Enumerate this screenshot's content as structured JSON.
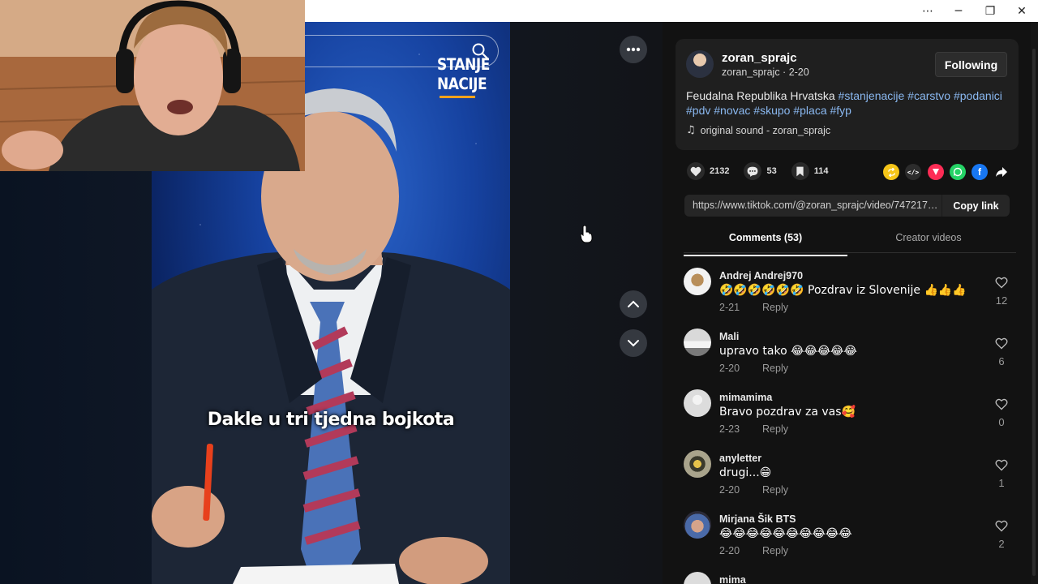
{
  "window": {
    "more_icon": "⋯",
    "minimize_icon": "─",
    "restore_icon": "❐",
    "close_icon": "✕"
  },
  "video": {
    "logo_line1": "STANJE",
    "logo_line2": "NACIJE",
    "subtitle": "Dakle u tri tjedna bojkota",
    "more_icon": "ellipsis-icon",
    "prev_icon": "chevron-up-icon",
    "next_icon": "chevron-down-icon"
  },
  "author": {
    "name": "zoran_sprajc",
    "handle": "zoran_sprajc",
    "separator": " · ",
    "date": "2-20",
    "follow_label": "Following"
  },
  "description": {
    "text": "Feudalna Republika Hrvatska ",
    "tags": [
      "#stanjenacije",
      "#carstvo",
      "#podanici",
      "#pdv",
      "#novac",
      "#skupo",
      "#placa",
      "#fyp"
    ],
    "sound": "original sound - zoran_sprajc"
  },
  "stats": {
    "likes": "2132",
    "comments": "53",
    "saves": "114"
  },
  "share_colors": {
    "repost": "#f5c518",
    "embed": "#2c2c2c",
    "send": "#fe2c55",
    "whatsapp": "#25d366",
    "facebook": "#1877f2"
  },
  "link": {
    "url": "https://www.tiktok.com/@zoran_sprajc/video/7472171...",
    "copy_label": "Copy link"
  },
  "tabs": {
    "comments": "Comments (53)",
    "creator": "Creator videos"
  },
  "reply_label": "Reply",
  "comments": [
    {
      "name": "Andrej Andrej970",
      "text": "🤣🤣🤣🤣🤣🤣 Pozdrav iz Slovenije 👍👍👍",
      "date": "2-21",
      "likes": "12"
    },
    {
      "name": "Mali",
      "text": "upravo tako 😂😂😂😂😂",
      "date": "2-20",
      "likes": "6"
    },
    {
      "name": "mimamima",
      "text": "Bravo pozdrav za vas🥰",
      "date": "2-23",
      "likes": "0"
    },
    {
      "name": "anyletter",
      "text": "drugi...😁",
      "date": "2-20",
      "likes": "1"
    },
    {
      "name": "Mirjana Šik BTS",
      "text": "😂😂😂😂😂😂😂😂😂😂",
      "date": "2-20",
      "likes": "2"
    },
    {
      "name": "mima",
      "text": "",
      "date": "",
      "likes": ""
    }
  ]
}
